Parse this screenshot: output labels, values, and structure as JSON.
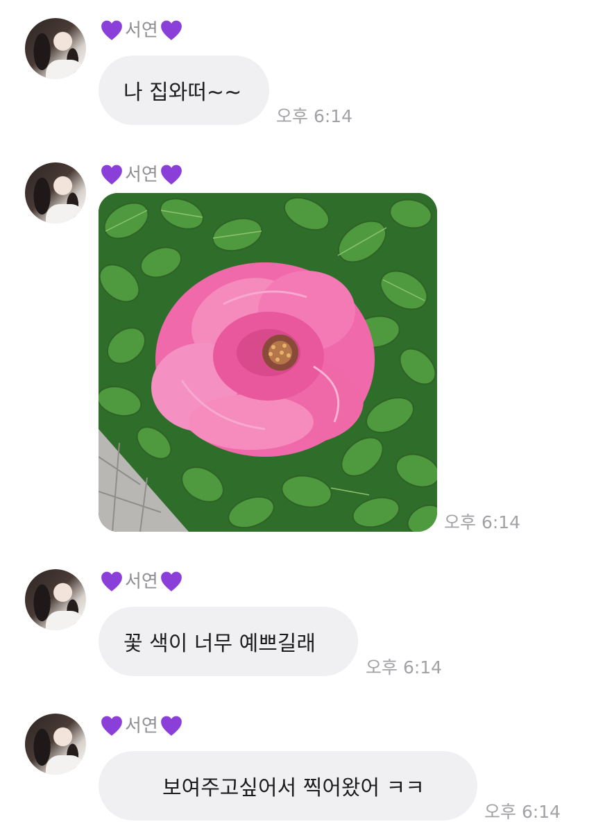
{
  "sender": {
    "name": "서연",
    "heart_color": "#8b3fd9",
    "icon": "purple-heart-icon"
  },
  "messages": [
    {
      "type": "text",
      "text": "나 집와떠~~",
      "time": "오후 6:14"
    },
    {
      "type": "image",
      "image": "pink-rose-photo",
      "time": "오후 6:14"
    },
    {
      "type": "text",
      "text": "꽃 색이 너무 예쁘길래",
      "time": "오후 6:14"
    },
    {
      "type": "text",
      "text": "보여주고싶어서 찍어왔어 ㅋㅋ",
      "time": "오후 6:14"
    }
  ],
  "colors": {
    "bubble_bg": "#f0f0f3",
    "time_text": "#a1a1a6",
    "name_text": "#8e8e93"
  }
}
